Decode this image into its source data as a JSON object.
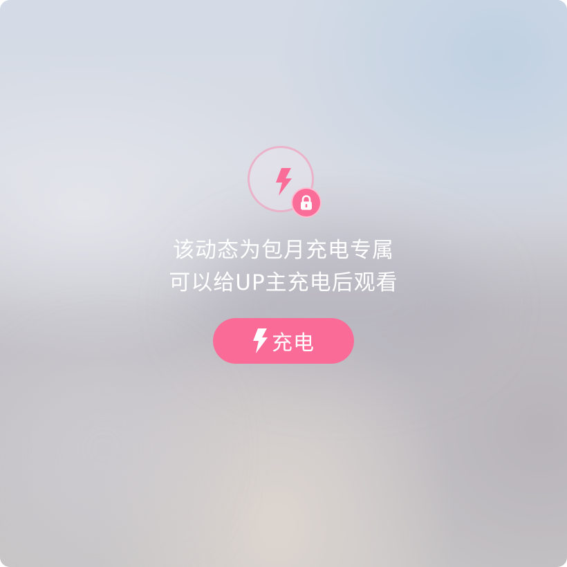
{
  "lock_notice": {
    "line1": "该动态为包月充电专属",
    "line2": "可以给UP主充电后观看",
    "badge_icon": "lightning-bolt-icon",
    "lock_icon": "lock-icon"
  },
  "charge_button": {
    "label": "充电",
    "icon": "lightning-bolt-icon"
  },
  "colors": {
    "accent": "#fb6b98",
    "text": "#ffffff"
  }
}
